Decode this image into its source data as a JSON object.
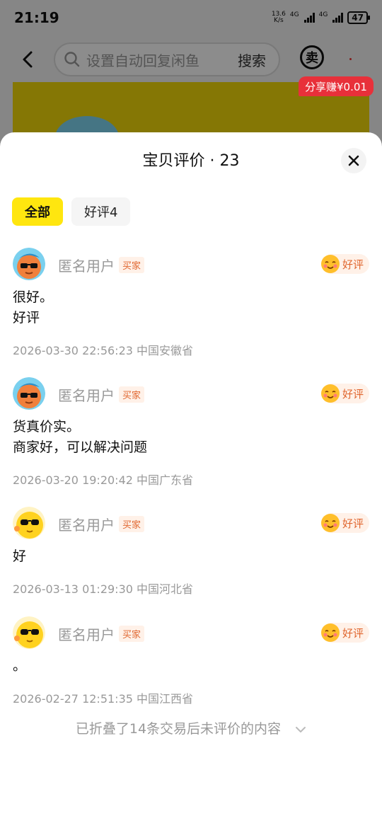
{
  "status_bar": {
    "time": "21:19",
    "net_speed_value": "13.6",
    "net_speed_unit": "K/s",
    "sim1": "4G",
    "sim2": "4G",
    "battery": "47"
  },
  "top_bar": {
    "search_placeholder": "设置自动回复闲鱼",
    "search_button": "搜索",
    "sell_icon_label": "卖",
    "share_badge": "分享赚¥0.01"
  },
  "sheet": {
    "title": "宝贝评价 · 23",
    "filters": [
      {
        "label": "全部",
        "active": true
      },
      {
        "label": "好评4",
        "active": false
      }
    ],
    "reviews": [
      {
        "user": "匿名用户",
        "tag": "买家",
        "rating": "好评",
        "avatar": "orange-sunglasses",
        "lines": [
          "很好。",
          "好评"
        ],
        "meta": "2026-03-30 22:56:23 中国安徽省"
      },
      {
        "user": "匿名用户",
        "tag": "买家",
        "rating": "好评",
        "avatar": "orange-sunglasses",
        "lines": [
          "货真价实。",
          "商家好，可以解决问题"
        ],
        "meta": "2026-03-20 19:20:42 中国广东省"
      },
      {
        "user": "匿名用户",
        "tag": "买家",
        "rating": "好评",
        "avatar": "yellow-sunglasses",
        "lines": [
          "好"
        ],
        "meta": "2026-03-13 01:29:30 中国河北省"
      },
      {
        "user": "匿名用户",
        "tag": "买家",
        "rating": "好评",
        "avatar": "yellow-sunglasses",
        "lines": [
          "。"
        ],
        "meta": "2026-02-27 12:51:35 中国江西省"
      }
    ],
    "folded_text": "已折叠了14条交易后未评价的内容"
  },
  "colors": {
    "accent_yellow": "#ffe60f",
    "share_red": "#e8303a",
    "rating_orange": "#e0662f"
  }
}
